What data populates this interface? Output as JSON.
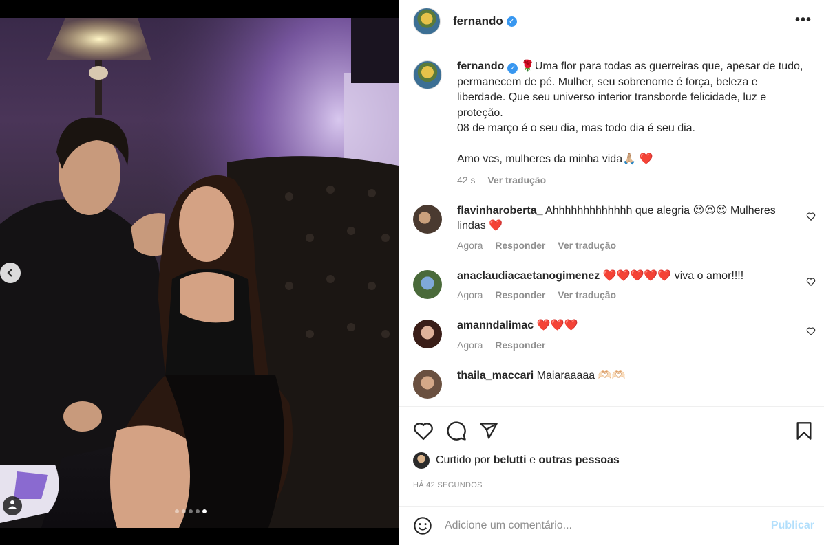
{
  "post": {
    "author": "fernando",
    "verified_badge": "✓",
    "caption_lines": [
      "Uma flor para todas as guerreiras que, apesar de tudo, permanecem de pé. Mulher, seu sobrenome é força, beleza e liberdade. Que seu universo interior transborde felicidade, luz e proteção.",
      "08 de março é o seu dia, mas todo dia é seu dia.",
      "Amo vcs, mulheres da minha vida🙏🏼 ❤️"
    ],
    "caption_prefix_icon": "🌹",
    "caption_time": "42 s",
    "see_translation": "Ver tradução",
    "more_icon": "•••",
    "carousel_count": 5,
    "carousel_active": 5
  },
  "comments": [
    {
      "user": "flavinharoberta_",
      "text": "Ahhhhhhhhhhhhh que alegria 😍😍😍 Mulheres lindas ❤️",
      "time": "Agora",
      "reply": "Responder",
      "translate": "Ver tradução"
    },
    {
      "user": "anaclaudiacaetanogimenez",
      "text": "❤️❤️❤️❤️❤️ viva o amor!!!!",
      "time": "Agora",
      "reply": "Responder",
      "translate": "Ver tradução"
    },
    {
      "user": "amanndalimac",
      "text": "❤️❤️❤️",
      "time": "Agora",
      "reply": "Responder",
      "translate": ""
    },
    {
      "user": "thaila_maccari",
      "text": "Maiaraaaaa 🫶🏻🫶🏻",
      "time": "",
      "reply": "",
      "translate": ""
    }
  ],
  "likes": {
    "prefix": "Curtido por",
    "user": "belutti",
    "joiner": "e",
    "others": "outras pessoas"
  },
  "timestamp": "HÁ 42 SEGUNDOS",
  "add_comment": {
    "placeholder": "Adicione um comentário...",
    "publish": "Publicar"
  },
  "colors": {
    "verified": "#3897f0",
    "heart": "#ed1c3a",
    "publish_disabled": "#b2dffc",
    "muted": "#8e8e8e"
  },
  "icons": [
    "chevron-left-icon",
    "user-tag-icon",
    "heart-icon",
    "comment-icon",
    "share-icon",
    "bookmark-icon",
    "emoji-icon",
    "more-icon"
  ]
}
